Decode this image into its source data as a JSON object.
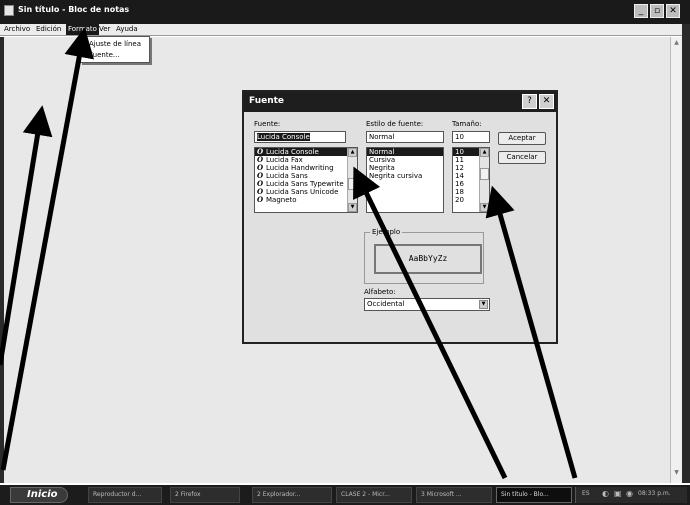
{
  "window": {
    "title": "Sin título - Bloc de notas",
    "minimize": "_",
    "maximize": "▫",
    "close": "✕"
  },
  "menubar": {
    "items": [
      "Archivo",
      "Edición",
      "Formato",
      "Ver",
      "Ayuda"
    ]
  },
  "format_menu": {
    "items": [
      "Ajuste de línea",
      "Fuente..."
    ]
  },
  "dialog": {
    "title": "Fuente",
    "help": "?",
    "close": "✕",
    "font_label": "Fuente:",
    "font_value": "Lucida Console",
    "fonts": [
      "Lucida Console",
      "Lucida Fax",
      "Lucida Handwriting",
      "Lucida Sans",
      "Lucida Sans Typewrite",
      "Lucida Sans Unicode",
      "Magneto"
    ],
    "style_label": "Estilo de fuente:",
    "style_value": "Normal",
    "styles": [
      "Normal",
      "Cursiva",
      "Negrita",
      "Negrita cursiva"
    ],
    "size_label": "Tamaño:",
    "size_value": "10",
    "sizes": [
      "10",
      "11",
      "12",
      "14",
      "16",
      "18",
      "20"
    ],
    "ok": "Aceptar",
    "cancel": "Cancelar",
    "sample_label": "Ejemplo",
    "sample_text": "AaBbYyZz",
    "script_label": "Alfabeto:",
    "script_value": "Occidental"
  },
  "taskbar": {
    "start": "Inicio",
    "tasks": [
      "Reproductor d...",
      "2 Firefox",
      "2 Explorador...",
      "CLASE 2 - Micr...",
      "3 Microsoft ...",
      "Sin título - Blo..."
    ],
    "lang": "ES",
    "clock": "08:33 p.m."
  }
}
